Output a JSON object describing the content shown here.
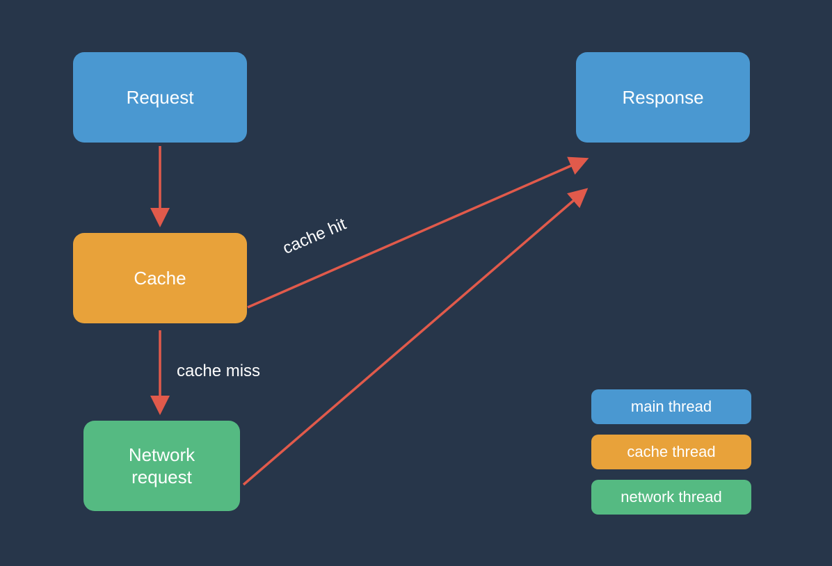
{
  "nodes": {
    "request": {
      "label": "Request"
    },
    "cache": {
      "label": "Cache"
    },
    "network": {
      "label": "Network\nrequest"
    },
    "response": {
      "label": "Response"
    }
  },
  "edges": {
    "request_to_cache": {
      "label": ""
    },
    "cache_to_response": {
      "label": "cache hit"
    },
    "cache_to_network": {
      "label": "cache miss"
    },
    "network_to_response": {
      "label": ""
    }
  },
  "legend": {
    "main": {
      "label": "main thread"
    },
    "cache": {
      "label": "cache thread"
    },
    "network": {
      "label": "network thread"
    }
  },
  "colors": {
    "blue": "#4a98d1",
    "orange": "#e8a23a",
    "green": "#55ba82",
    "arrow": "#e15a4b",
    "bg": "#27364a",
    "text": "#ffffff"
  }
}
